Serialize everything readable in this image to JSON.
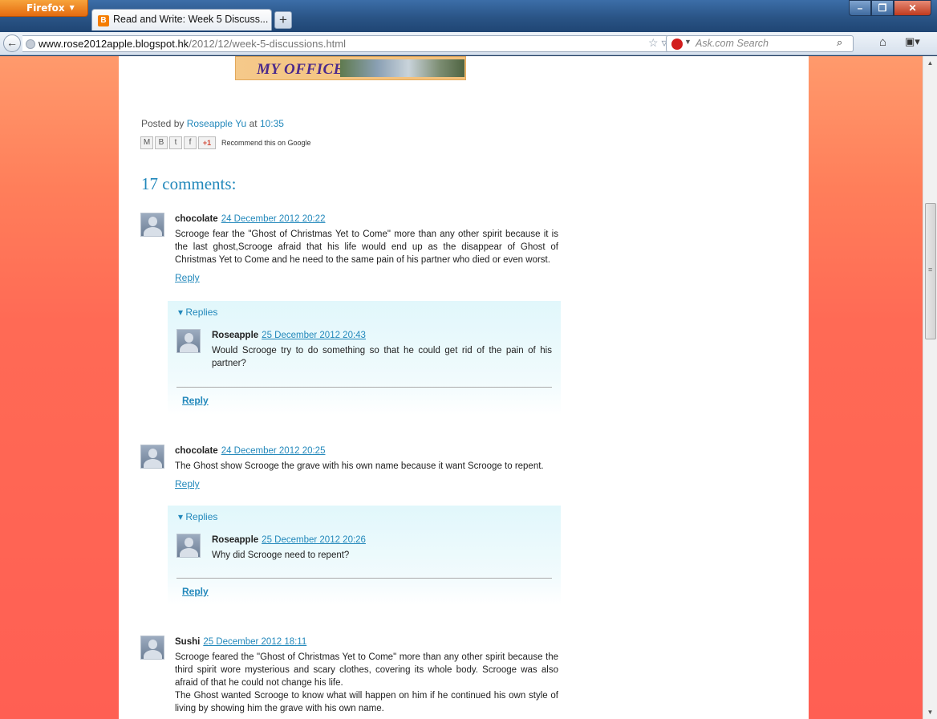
{
  "browser": {
    "app_button": "Firefox",
    "tab_title": "Read and Write: Week 5 Discuss...",
    "new_tab": "+",
    "url_host": "www.rose2012apple.blogspot.hk",
    "url_path": "/2012/12/week-5-discussions.html",
    "search_placeholder": "Ask.com Search"
  },
  "post": {
    "banner_text": "MY OFFICE",
    "posted_by_label": "Posted by",
    "author": "Roseapple Yu",
    "at_label": "at",
    "time": "10:35",
    "share_recommend": "Recommend this on Google",
    "share_gplus": "+1"
  },
  "comments_heading": "17 comments:",
  "comments": [
    {
      "author": "chocolate",
      "date": "24 December 2012 20:22",
      "text": "Scrooge fear the \"Ghost of Christmas Yet to Come\" more than any other spirit because it is the last ghost,Scrooge afraid that his life would end up as the disappear of Ghost of Christmas Yet to Come and he need to the same pain of his partner who died or even worst.",
      "reply_label": "Reply",
      "replies_toggle": "Replies",
      "reply": {
        "author": "Roseapple",
        "date": "25 December 2012 20:43",
        "text": "Would Scrooge try to do something so that he could get rid of the pain of his partner?"
      },
      "reply_button": "Reply"
    },
    {
      "author": "chocolate",
      "date": "24 December 2012 20:25",
      "text": "The Ghost show Scrooge the grave with his own name because it want Scrooge to repent.",
      "reply_label": "Reply",
      "replies_toggle": "Replies",
      "reply": {
        "author": "Roseapple",
        "date": "25 December 2012 20:26",
        "text": "Why did Scrooge need to repent?"
      },
      "reply_button": "Reply"
    },
    {
      "author": "Sushi",
      "date": "25 December 2012 18:11",
      "text": "Scrooge feared the \"Ghost of Christmas Yet to Come\" more than any other spirit because the third spirit wore mysterious and scary clothes, covering its whole body. Scrooge was also afraid of that he could not change his life.",
      "text2": "The Ghost wanted Scrooge to know what will happen on him if he continued his own style of living by showing him the grave with his own name."
    }
  ]
}
